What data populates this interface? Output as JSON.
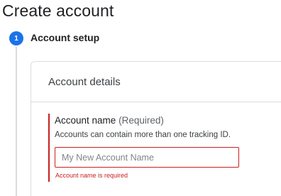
{
  "header": {
    "title": "Create account"
  },
  "stepper": {
    "step_number": "1",
    "step_title": "Account setup"
  },
  "card": {
    "title": "Account details"
  },
  "account_name_field": {
    "label": "Account name",
    "required_text": "(Required)",
    "help_text": "Accounts can contain more than one tracking ID.",
    "placeholder": "My New Account Name",
    "value": "",
    "error_text": "Account name is required"
  },
  "colors": {
    "accent": "#1a73e8",
    "error": "#c5221f",
    "border": "#dadce0"
  }
}
